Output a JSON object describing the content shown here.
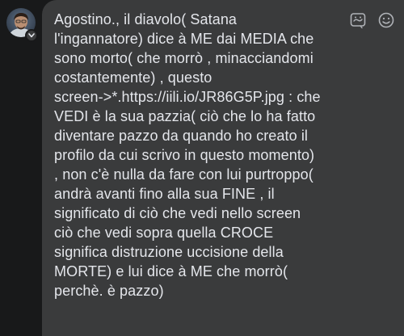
{
  "comment": {
    "text": "Agostino., il diavolo( Satana\nl'ingannatore) dice à ME dai MEDIA che\nsono morto( che morrò , minacciandomi\ncostantemente) , questo\nscreen->*.https://iili.io/JR86G5P.jpg : che\nVEDI è la sua pazzia( ciò che lo ha fatto\ndiventare pazzo da quando ho creato il\nprofilo da cui scrivo in questo momento)\n, non c'è nulla da fare con lui purtroppo(\nandrà avanti fino alla sua FINE , il\nsignificato di ciò che vedi nello screen\nciò che vedi sopra quella CROCE\nsignifica distruzione uccisione della\nMORTE) e lui dice à ME che morrò(\nperchè. è pazzo)"
  },
  "icons": {
    "avatar": "profile-avatar",
    "avatar_badge": "chevron-down-icon",
    "gif": "gif-sticker-icon",
    "emoji": "emoji-icon"
  },
  "colors": {
    "background": "#18191a",
    "bubble": "#3a3b3c",
    "text": "#e4e6eb",
    "icon": "#b0b3b8"
  }
}
